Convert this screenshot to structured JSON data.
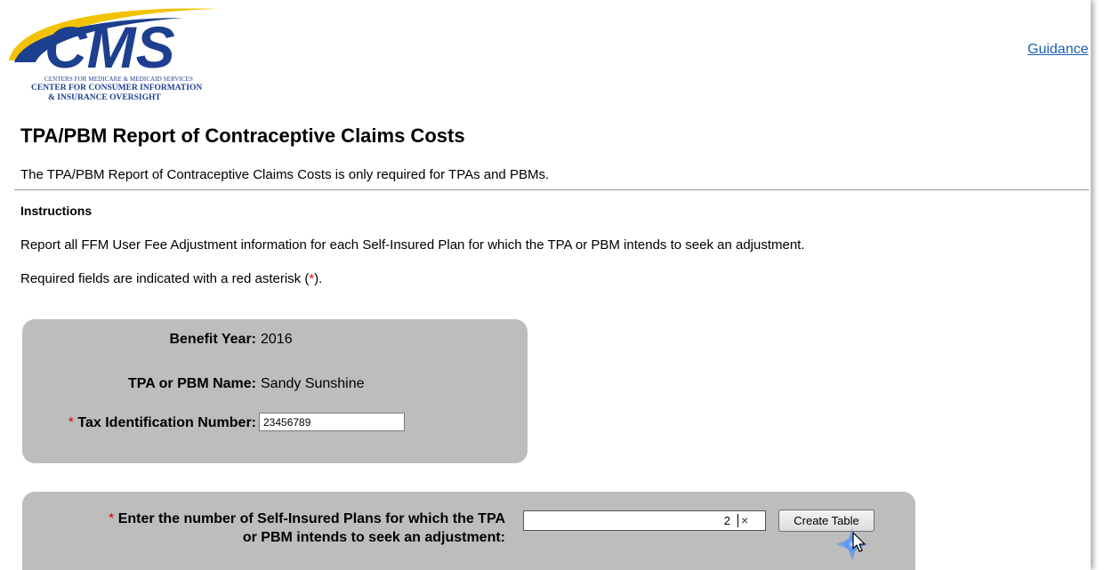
{
  "logo": {
    "wordmark": "CMS",
    "line1": "CENTERS FOR MEDICARE & MEDICAID SERVICES",
    "line2": "CENTER FOR CONSUMER INFORMATION",
    "line3": "& INSURANCE OVERSIGHT"
  },
  "header": {
    "guidance_link": "Guidance"
  },
  "page": {
    "title": "TPA/PBM Report of Contraceptive Claims Costs",
    "description": "The TPA/PBM Report of Contraceptive Claims Costs is only required for TPAs and PBMs."
  },
  "instructions": {
    "heading": "Instructions",
    "line1": "Report all FFM User Fee Adjustment information for each Self-Insured Plan for which the TPA or PBM intends to seek an adjustment.",
    "required_prefix": "Required fields are indicated with a red asterisk (",
    "required_asterisk": "*",
    "required_suffix": ")."
  },
  "details": {
    "benefit_year_label": "Benefit Year:",
    "benefit_year_value": "2016",
    "tpa_name_label": "TPA or PBM Name:",
    "tpa_name_value": "Sandy Sunshine",
    "tax_id_label": "Tax Identification Number:",
    "tax_id_value": "23456789",
    "asterisk": "*"
  },
  "plans": {
    "label_line1": "Enter the number of Self-Insured Plans for which the TPA",
    "label_line2": "or PBM intends to seek an adjustment:",
    "asterisk": "*",
    "count_value": "2",
    "clear_glyph": "×",
    "create_button": "Create Table"
  },
  "colors": {
    "brand_blue": "#1d3f8f",
    "brand_yellow": "#f2c300",
    "link": "#1a5fb4",
    "required": "#e00000",
    "panel": "#bdbdbd"
  }
}
